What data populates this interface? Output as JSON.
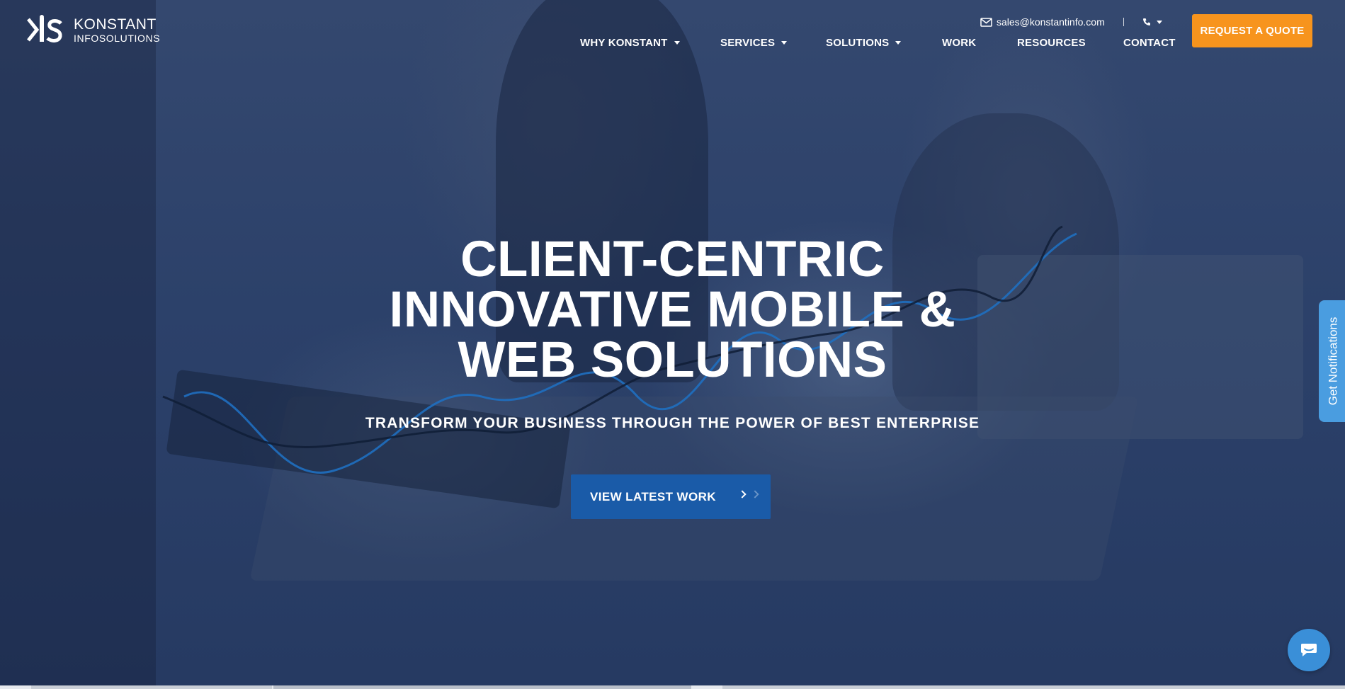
{
  "brand": {
    "name": "KONSTANT",
    "subtitle": "INFOSOLUTIONS"
  },
  "topbar": {
    "email": "sales@konstantinfo.com",
    "email_icon": "mail-icon",
    "phone_icon": "phone-icon"
  },
  "nav": {
    "items": [
      {
        "label": "WHY KONSTANT",
        "has_dropdown": true
      },
      {
        "label": "SERVICES",
        "has_dropdown": true
      },
      {
        "label": "SOLUTIONS",
        "has_dropdown": true
      },
      {
        "label": "WORK",
        "has_dropdown": false
      },
      {
        "label": "RESOURCES",
        "has_dropdown": false
      },
      {
        "label": "CONTACT",
        "has_dropdown": false
      }
    ],
    "quote_button": "REQUEST A QUOTE"
  },
  "hero": {
    "headline_line1": "CLIENT-CENTRIC",
    "headline_line2": "INNOVATIVE MOBILE &",
    "headline_line3": "WEB SOLUTIONS",
    "subheadline": "TRANSFORM YOUR BUSINESS THROUGH THE POWER OF BEST ENTERPRISE",
    "cta_label": "VIEW LATEST WORK"
  },
  "side_tab": {
    "label": "Get Notifications"
  },
  "chat": {
    "icon": "chat-icon"
  },
  "colors": {
    "accent_orange": "#f7941d",
    "cta_blue": "#1a5ba8",
    "notify_blue": "#4a9de0",
    "overlay_navy": "#2c416a"
  }
}
